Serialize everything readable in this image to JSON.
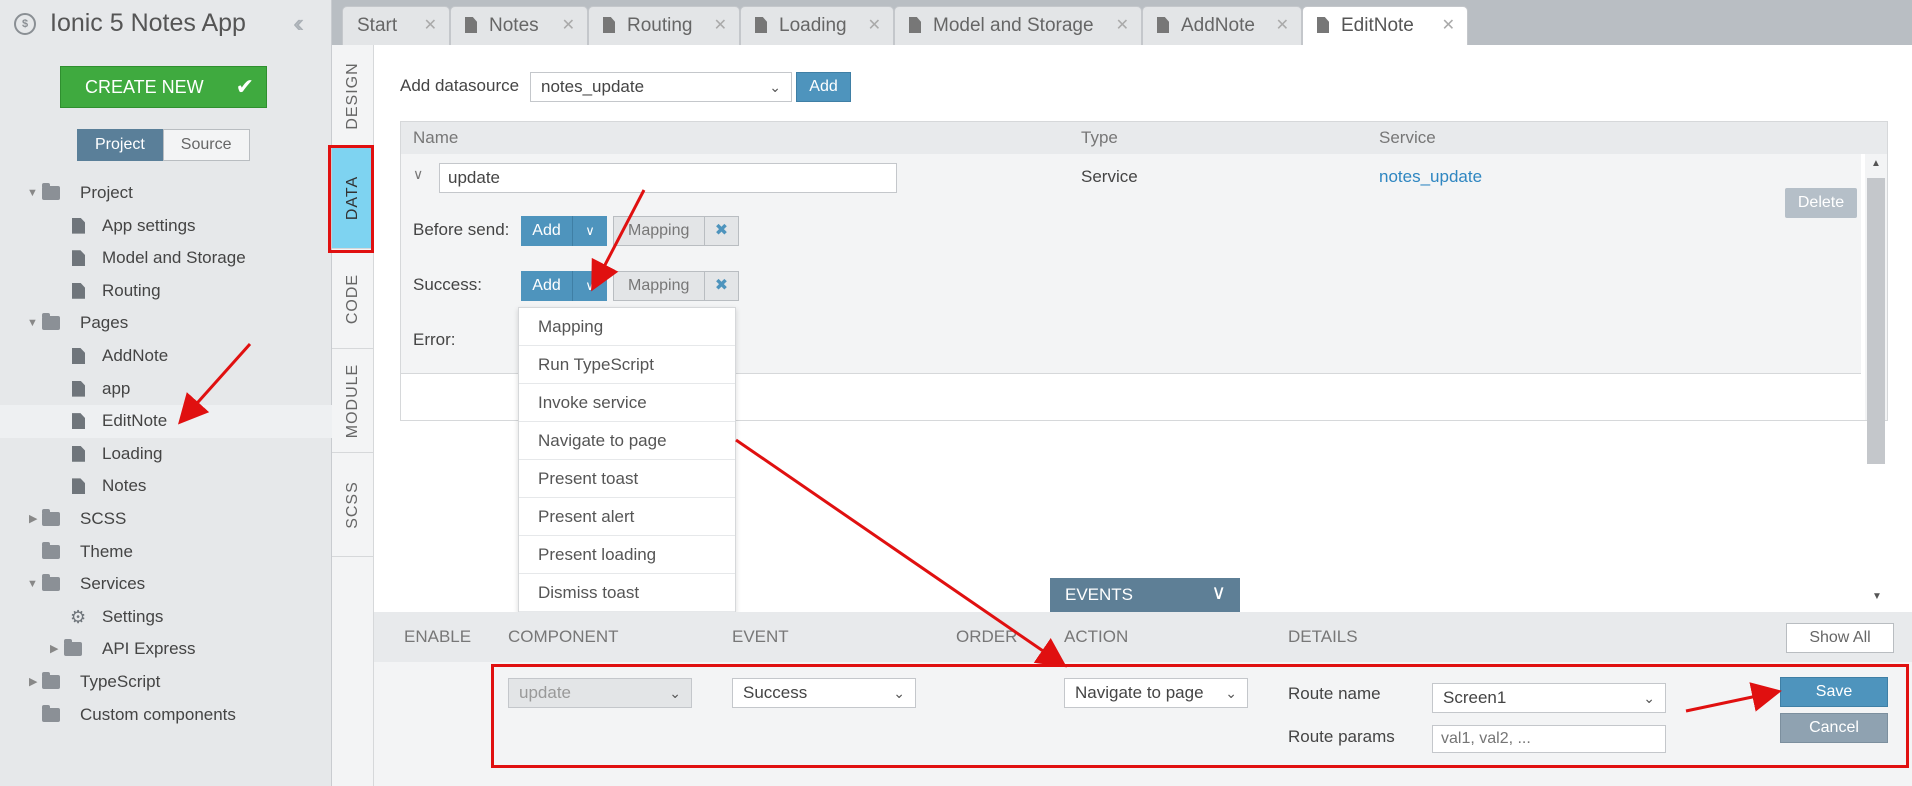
{
  "app": {
    "title": "Ionic 5 Notes App",
    "create_label": "CREATE NEW",
    "seg_project": "Project",
    "seg_source": "Source"
  },
  "tree": {
    "project": "Project",
    "app_settings": "App settings",
    "model_storage": "Model and Storage",
    "routing": "Routing",
    "pages": "Pages",
    "addnote": "AddNote",
    "app": "app",
    "editnote": "EditNote",
    "loading": "Loading",
    "notes": "Notes",
    "scss": "SCSS",
    "theme": "Theme",
    "services": "Services",
    "settings": "Settings",
    "api_express": "API Express",
    "typescript": "TypeScript",
    "custom_components": "Custom components"
  },
  "tabs": [
    "Start",
    "Notes",
    "Routing",
    "Loading",
    "Model and Storage",
    "AddNote",
    "EditNote"
  ],
  "vtabs": {
    "design": "DESIGN",
    "data": "DATA",
    "code": "CODE",
    "module": "MODULE",
    "scss": "SCSS"
  },
  "datasource": {
    "label": "Add datasource",
    "selected": "notes_update",
    "add": "Add",
    "col_name": "Name",
    "col_type": "Type",
    "col_service": "Service",
    "name_value": "update",
    "type_value": "Service",
    "service_value": "notes_update",
    "delete": "Delete",
    "before_send": "Before send:",
    "success": "Success:",
    "error": "Error:",
    "add_label": "Add",
    "mapping": "Mapping"
  },
  "menu": [
    "Mapping",
    "Run TypeScript",
    "Invoke service",
    "Navigate to page",
    "Present toast",
    "Present alert",
    "Present loading",
    "Dismiss toast"
  ],
  "events": {
    "tab_label": "EVENTS",
    "cols": {
      "enable": "ENABLE",
      "component": "COMPONENT",
      "event": "EVENT",
      "order": "ORDER",
      "action": "ACTION",
      "details": "DETAILS"
    },
    "show_all": "Show All",
    "component_value": "update",
    "event_value": "Success",
    "action_value": "Navigate to page",
    "route_name_label": "Route name",
    "route_name_value": "Screen1",
    "route_params_label": "Route params",
    "route_params_placeholder": "val1, val2, ...",
    "save": "Save",
    "cancel": "Cancel"
  },
  "colors": {
    "accent": "#4e94bd",
    "create": "#3faa3f",
    "active_vtab": "#7ed3f1",
    "annotation": "#e01010"
  }
}
